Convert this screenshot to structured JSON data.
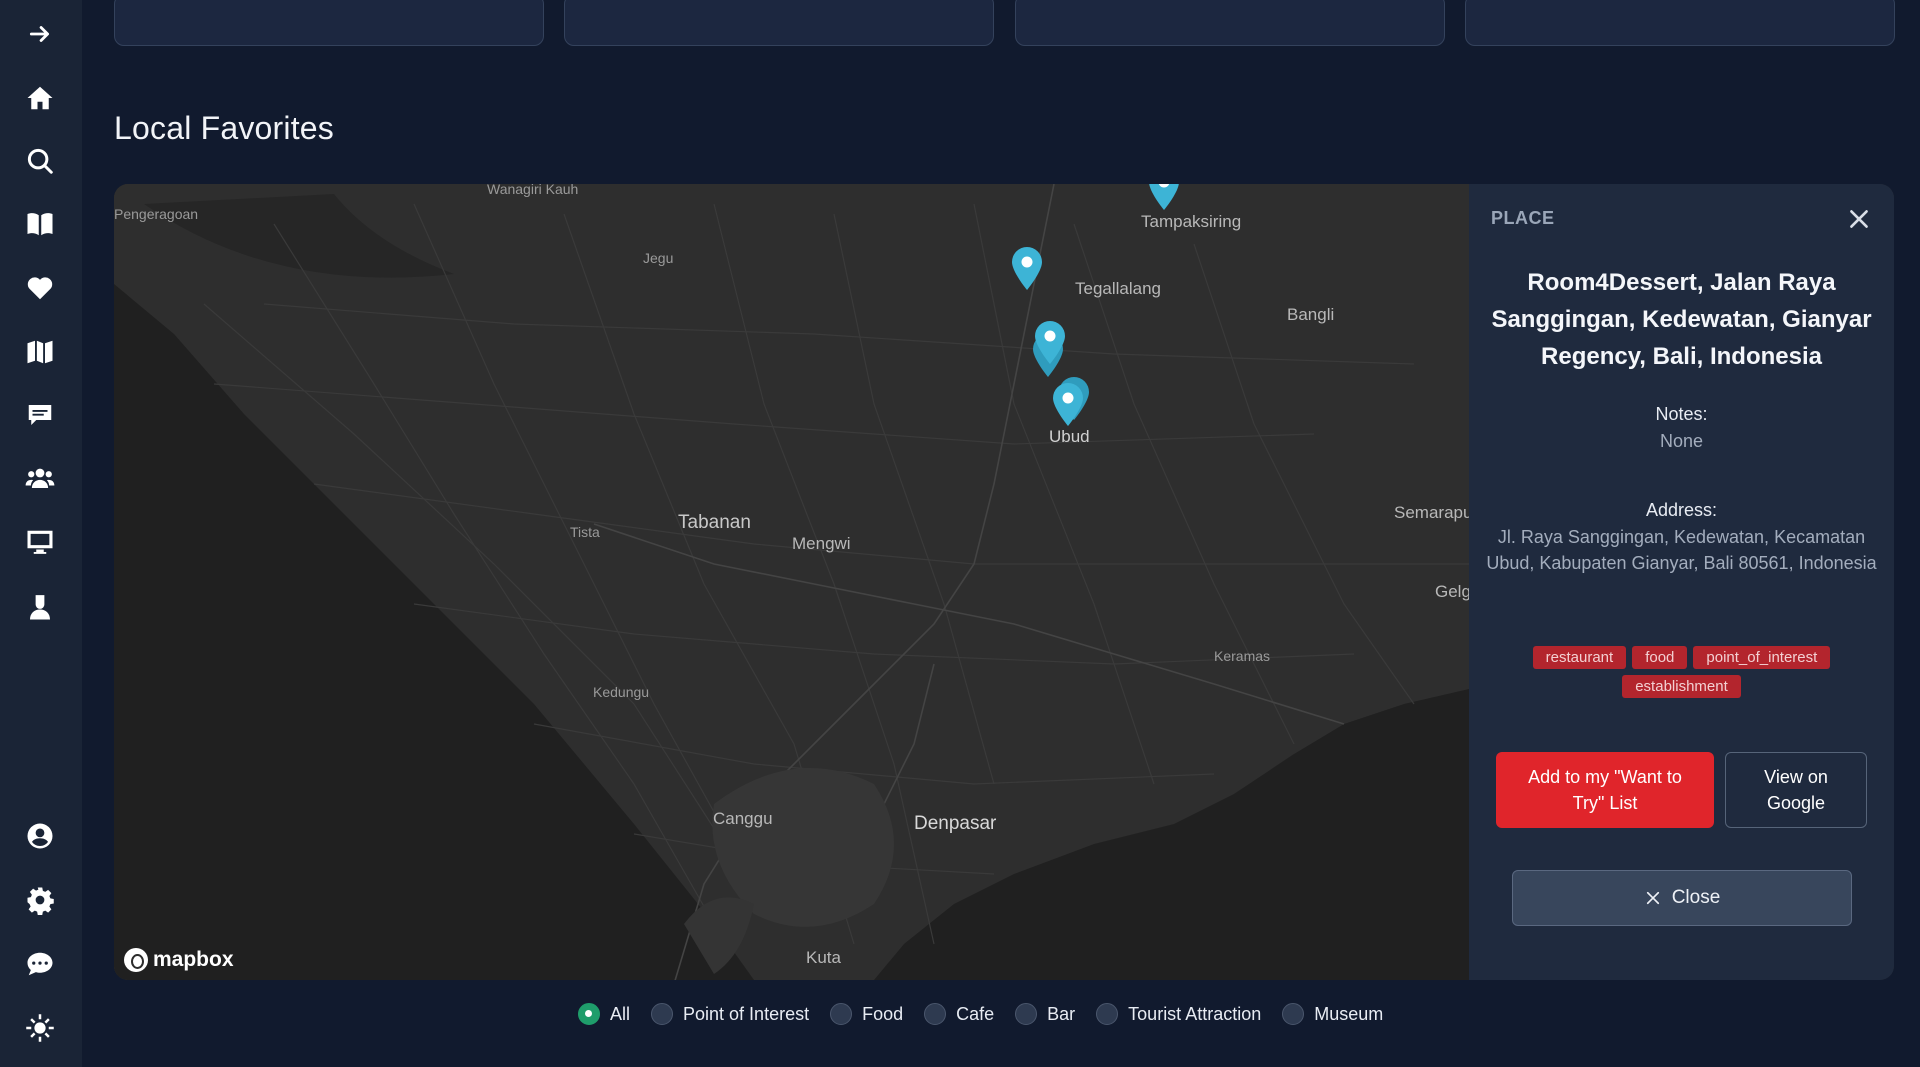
{
  "section_title": "Local Favorites",
  "map": {
    "attribution": "mapbox",
    "labels": {
      "wanagiri": "Wanagiri Kauh",
      "pengeragoan": "Pengeragoan",
      "jegu": "Jegu",
      "tampaksiring": "Tampaksiring",
      "tegallalang": "Tegallalang",
      "bangli": "Bangli",
      "ubud": "Ubud",
      "tabanan": "Tabanan",
      "tista": "Tista",
      "mengwi": "Mengwi",
      "semarapura": "Semarapu",
      "gelgel": "Gelg",
      "keramas": "Keramas",
      "kedungu": "Kedungu",
      "canggu": "Canggu",
      "denpasar": "Denpasar",
      "kuta": "Kuta"
    },
    "pin_color": "#3db4d6"
  },
  "panel": {
    "label": "PLACE",
    "place_name": "Room4Dessert, Jalan Raya Sanggingan, Kedewatan, Gianyar Regency, Bali, Indonesia",
    "notes_label": "Notes:",
    "notes_value": "None",
    "address_label": "Address:",
    "address_value": "Jl. Raya Sanggingan, Kedewatan, Kecamatan Ubud, Kabupaten Gianyar, Bali 80561, Indonesia",
    "tags": [
      "restaurant",
      "food",
      "point_of_interest",
      "establishment"
    ],
    "add_button": "Add to my \"Want to Try\" List",
    "google_button": "View on Google",
    "close_button": "Close"
  },
  "filters": {
    "options": [
      "All",
      "Point of Interest",
      "Food",
      "Cafe",
      "Bar",
      "Tourist Attraction",
      "Museum"
    ],
    "selected": "All"
  },
  "colors": {
    "background": "#111a2e",
    "sidebar": "#1a2436",
    "panel": "#1f2a3e",
    "accent_red": "#e0252b",
    "tag_red": "#b3252d",
    "radio_selected": "#1f9d6b"
  },
  "sidebar_icons": [
    "arrow-right-icon",
    "home-icon",
    "search-icon",
    "book-icon",
    "heart-icon",
    "map-icon",
    "chat-icon",
    "users-icon",
    "monitor-icon",
    "user-icon",
    "account-circle-icon",
    "gear-icon",
    "message-icon",
    "sun-icon"
  ]
}
